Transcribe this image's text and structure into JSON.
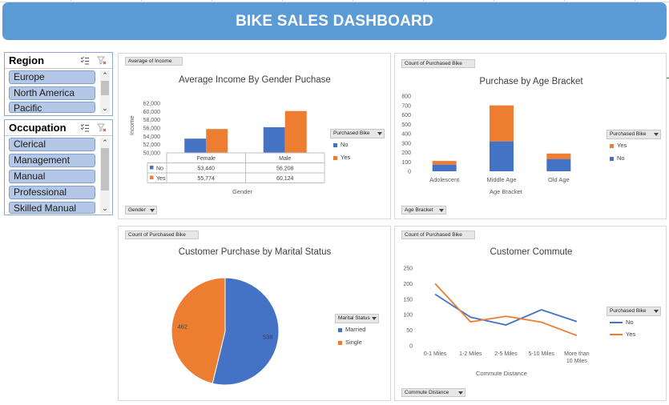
{
  "dashboard": {
    "title": "BIKE SALES DASHBOARD"
  },
  "colors": {
    "blue": "#4472c4",
    "orange": "#ed7d31",
    "banner": "#5b9bd5",
    "slicer_item": "#b4c7e7"
  },
  "slicers": {
    "region": {
      "title": "Region",
      "items": [
        "Europe",
        "North America",
        "Pacific"
      ]
    },
    "occupation": {
      "title": "Occupation",
      "items": [
        "Clerical",
        "Management",
        "Manual",
        "Professional",
        "Skilled Manual"
      ]
    }
  },
  "icons": [
    "multi-select-icon",
    "clear-filter-icon",
    "scroll-up-icon",
    "scroll-down-icon",
    "dropdown-arrow-icon"
  ],
  "charts": {
    "income": {
      "value_button": "Average of Income",
      "axis_button": "Gender",
      "legend_button": "Purchased Bike",
      "ylabel": "Income",
      "xlabel": "Gender",
      "y_ticks": [
        "62,000",
        "60,000",
        "58,000",
        "56,000",
        "54,000",
        "52,000",
        "50,000"
      ],
      "table": {
        "columns": [
          "Female",
          "Male"
        ],
        "rows": [
          {
            "label": "No",
            "values": [
              "53,440",
              "56,208"
            ]
          },
          {
            "label": "Yes",
            "values": [
              "55,774",
              "60,124"
            ]
          }
        ]
      }
    },
    "age": {
      "value_button": "Count of Purchased Bike",
      "axis_button": "Age Bracket",
      "legend_button": "Purchased Bike",
      "xlabel": "Age Bracket",
      "y_ticks": [
        "800",
        "700",
        "600",
        "500",
        "400",
        "300",
        "200",
        "100",
        "0"
      ],
      "legend": [
        "Yes",
        "No"
      ]
    },
    "marital": {
      "value_button": "Count of Purchased Bike",
      "legend_button": "Marital Status",
      "legend": [
        "Married",
        "Single"
      ],
      "slice_labels": [
        "538",
        "462"
      ]
    },
    "commute": {
      "value_button": "Count of Purchased Bike",
      "axis_button": "Commute Distance",
      "legend_button": "Purchased Bike",
      "xlabel": "Commute Distance",
      "y_ticks": [
        "250",
        "200",
        "150",
        "100",
        "50",
        "0"
      ],
      "legend": [
        "No",
        "Yes"
      ]
    }
  },
  "chart_data": [
    {
      "type": "bar",
      "title": "Average Income By Gender Puchase",
      "xlabel": "Gender",
      "ylabel": "Income",
      "categories": [
        "Female",
        "Male"
      ],
      "series": [
        {
          "name": "No",
          "values": [
            53440,
            56208
          ]
        },
        {
          "name": "Yes",
          "values": [
            55774,
            60124
          ]
        }
      ],
      "ylim": [
        50000,
        62000
      ],
      "legend": "right"
    },
    {
      "type": "bar",
      "stacked": true,
      "title": "Purchase by Age Bracket",
      "xlabel": "Age Bracket",
      "categories": [
        "Adolescent",
        "Middle Age",
        "Old Age"
      ],
      "series": [
        {
          "name": "No",
          "values": [
            71,
            318,
            131
          ]
        },
        {
          "name": "Yes",
          "values": [
            39,
            383,
            58
          ]
        }
      ],
      "ylim": [
        0,
        800
      ],
      "legend": "right"
    },
    {
      "type": "pie",
      "title": "Customer Purchase by Marital Status",
      "categories": [
        "Married",
        "Single"
      ],
      "values": [
        538,
        462
      ],
      "legend": "right"
    },
    {
      "type": "line",
      "title": "Customer Commute",
      "xlabel": "Commute Distance",
      "categories": [
        "0-1 Miles",
        "1-2 Miles",
        "2-5 Miles",
        "5-10 Miles",
        "More than 10 Miles"
      ],
      "series": [
        {
          "name": "No",
          "values": [
            166,
            92,
            67,
            116,
            78
          ]
        },
        {
          "name": "Yes",
          "values": [
            200,
            77,
            95,
            76,
            33
          ]
        }
      ],
      "ylim": [
        0,
        250
      ],
      "legend": "right"
    }
  ]
}
